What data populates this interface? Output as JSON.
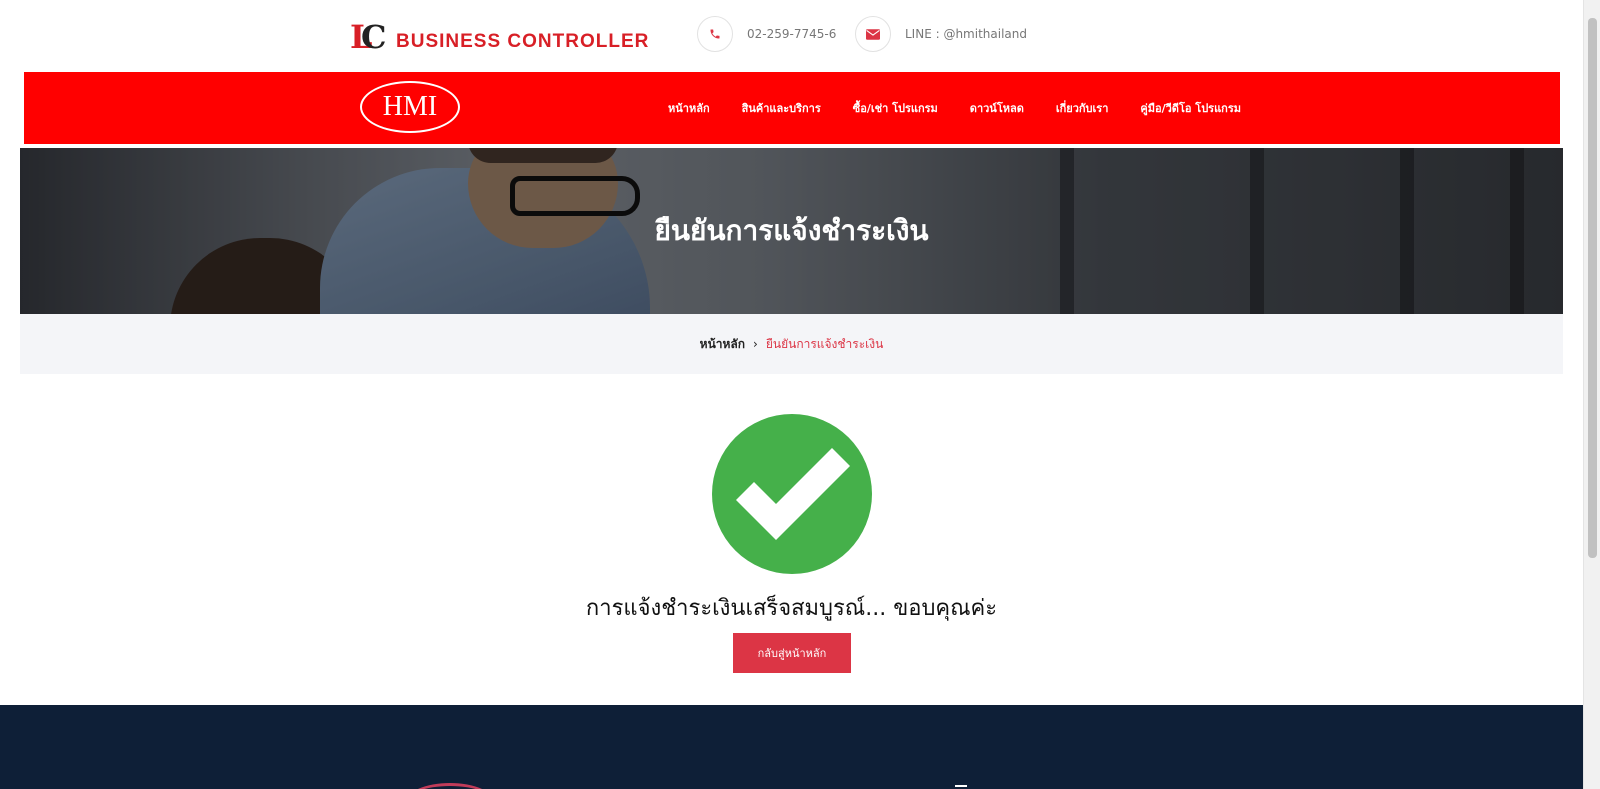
{
  "brand": {
    "name": "BUSINESS CONTROLLER",
    "logo_letters": "LC"
  },
  "contacts": {
    "phone": "02-259-7745-6",
    "line": "LINE : @hmithailand"
  },
  "nav": {
    "logo_text": "HMI",
    "items": [
      {
        "label": "หน้าหลัก"
      },
      {
        "label": "สินค้าและบริการ"
      },
      {
        "label": "ซื้อ/เช่า โปรแกรม"
      },
      {
        "label": "ดาวน์โหลด"
      },
      {
        "label": "เกี่ยวกับเรา"
      },
      {
        "label": "คู่มือ/วีดีโอ โปรแกรม"
      }
    ]
  },
  "hero": {
    "title": "ยืนยันการแจ้งชำระเงิน"
  },
  "breadcrumb": {
    "home": "หน้าหลัก",
    "separator": "›",
    "current": "ยืนยันการแจ้งชำระเงิน"
  },
  "success": {
    "icon": "check-circle-icon",
    "message": "การแจ้งชำระเงินเสร็จสมบูรณ์... ขอบคุณค่ะ",
    "button_label": "กลับสู่หน้าหลัก"
  },
  "colors": {
    "nav_bg": "#ff0000",
    "accent": "#dc3545",
    "success": "#45b04a",
    "footer_bg": "#0e1f37",
    "breadcrumb_bg": "#f4f5f8"
  }
}
